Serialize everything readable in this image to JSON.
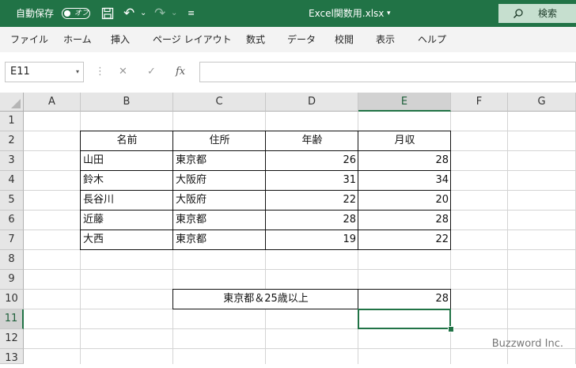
{
  "titlebar": {
    "autosave_label": "自動保存",
    "autosave_state": "オフ",
    "filename": "Excel関数用.xlsx",
    "filename_dropdown": "▾",
    "search_label": "検索",
    "icons": {
      "save": "save-icon",
      "undo": "undo-icon",
      "redo": "redo-icon",
      "customize": "customize-qat-icon",
      "search": "search-icon"
    },
    "undo_glyph": "↶",
    "redo_glyph": "↷",
    "small_dropdown": "⌄",
    "customize_glyph": "≡",
    "search_glyph": "⚲"
  },
  "menu": [
    "ファイル",
    "ホーム",
    "挿入",
    "ページ レイアウト",
    "数式",
    "データ",
    "校閲",
    "表示",
    "ヘルプ"
  ],
  "formula_bar": {
    "namebox": "E11",
    "namebox_dropdown": "▾",
    "separator": "⋮",
    "cancel": "✕",
    "enter": "✓",
    "fx": "fx",
    "value": ""
  },
  "grid": {
    "columns": [
      "A",
      "B",
      "C",
      "D",
      "E",
      "F",
      "G"
    ],
    "rows": [
      "1",
      "2",
      "3",
      "4",
      "5",
      "6",
      "7",
      "8",
      "9",
      "10",
      "11",
      "12",
      "13"
    ],
    "selected_cell": "E11",
    "selected_col": "E",
    "selected_row": "11",
    "header_row": {
      "B": "名前",
      "C": "住所",
      "D": "年齢",
      "E": "月収"
    },
    "table_rows": [
      {
        "name": "山田",
        "address": "東京都",
        "age": "26",
        "income": "28"
      },
      {
        "name": "鈴木",
        "address": "大阪府",
        "age": "31",
        "income": "34"
      },
      {
        "name": "長谷川",
        "address": "大阪府",
        "age": "22",
        "income": "20"
      },
      {
        "name": "近藤",
        "address": "東京都",
        "age": "28",
        "income": "28"
      },
      {
        "name": "大西",
        "address": "東京都",
        "age": "19",
        "income": "22"
      }
    ],
    "criteria_label": "東京都＆25歳以上",
    "criteria_result": "28"
  },
  "watermark": "Buzzword Inc.",
  "colors": {
    "excel_green": "#217346",
    "menu_bg": "#f3f3f3",
    "header_bg": "#e6e6e6"
  }
}
